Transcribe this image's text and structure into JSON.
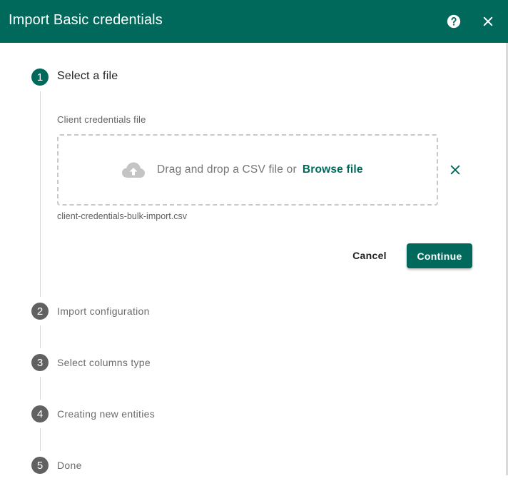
{
  "dialog": {
    "title": "Import Basic credentials",
    "help_icon": "help-circle-icon",
    "close_icon": "close-icon"
  },
  "colors": {
    "primary": "#00695c",
    "inactive_step": "#616161"
  },
  "steps": [
    {
      "number": "1",
      "label": "Select a file",
      "state": "active"
    },
    {
      "number": "2",
      "label": "Import configuration",
      "state": "inactive"
    },
    {
      "number": "3",
      "label": "Select columns type",
      "state": "inactive"
    },
    {
      "number": "4",
      "label": "Creating new entities",
      "state": "inactive"
    },
    {
      "number": "5",
      "label": "Done",
      "state": "inactive"
    }
  ],
  "file_step": {
    "field_label": "Client credentials file",
    "dropzone_text": "Drag and drop a CSV file or",
    "browse_label": "Browse file",
    "upload_icon": "cloud-upload-icon",
    "clear_icon": "close-icon",
    "selected_file": "client-credentials-bulk-import.csv",
    "cancel_label": "Cancel",
    "continue_label": "Continue"
  }
}
